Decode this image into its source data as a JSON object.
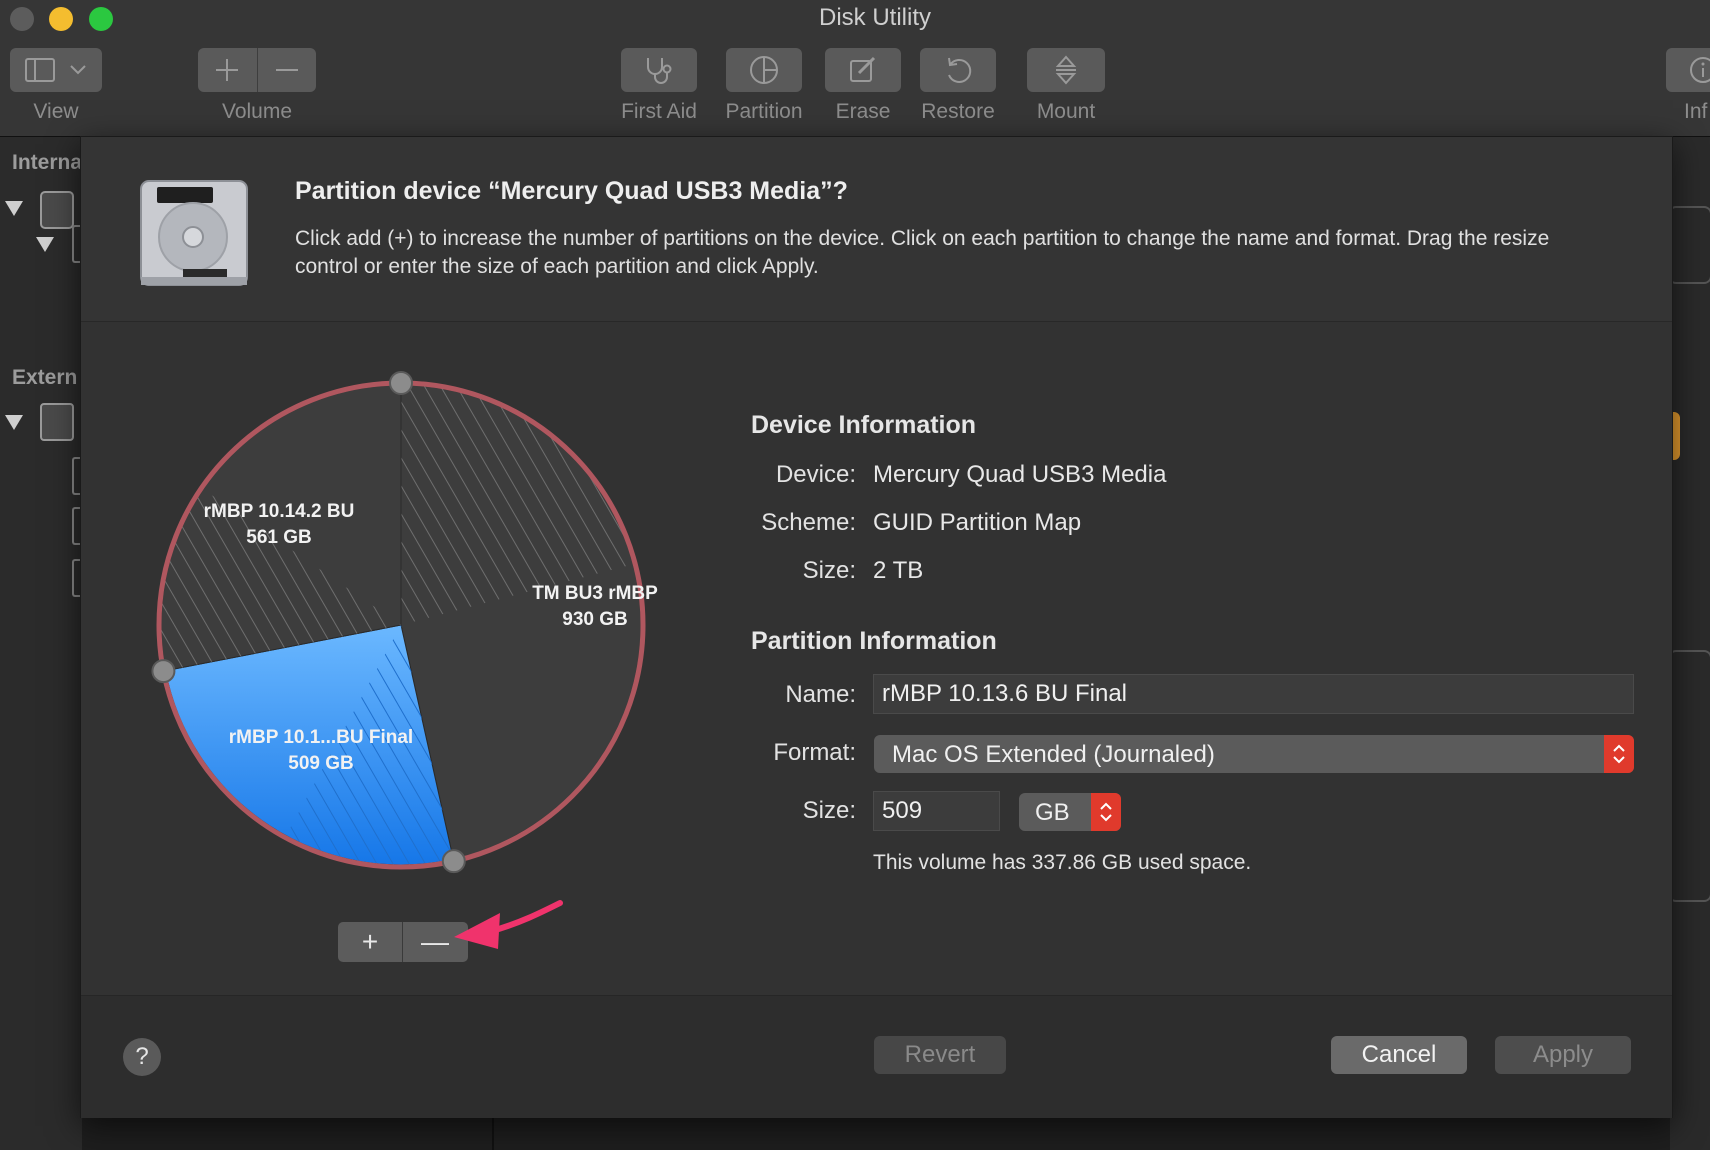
{
  "window": {
    "title": "Disk Utility"
  },
  "toolbar": {
    "view_label": "View",
    "volume_label": "Volume",
    "first_aid_label": "First Aid",
    "partition_label": "Partition",
    "erase_label": "Erase",
    "restore_label": "Restore",
    "mount_label": "Mount",
    "info_label": "Inf"
  },
  "sidebar": {
    "internal_header": "Interna",
    "external_header": "Extern"
  },
  "sheet": {
    "title": "Partition device “Mercury Quad USB3 Media”?",
    "description": "Click add (+) to increase the number of partitions on the device. Click on each partition to change the name and format. Drag the resize control or enter the size of each partition and click Apply."
  },
  "pie": {
    "partitions": [
      {
        "name": "rMBP 10.14.2 BU",
        "size": "561 GB",
        "gb": 561,
        "selected": false
      },
      {
        "name": "TM BU3 rMBP",
        "size": "930 GB",
        "gb": 930,
        "selected": false
      },
      {
        "name": "rMBP 10.1...BU Final",
        "size": "509 GB",
        "gb": 509,
        "selected": true
      }
    ],
    "add_symbol": "+",
    "remove_symbol": "—"
  },
  "device_info": {
    "header": "Device Information",
    "device_label": "Device:",
    "device_value": "Mercury Quad USB3 Media",
    "scheme_label": "Scheme:",
    "scheme_value": "GUID Partition Map",
    "size_label": "Size:",
    "size_value": "2 TB"
  },
  "partition_info": {
    "header": "Partition Information",
    "name_label": "Name:",
    "name_value": "rMBP 10.13.6 BU Final",
    "format_label": "Format:",
    "format_value": "Mac OS Extended (Journaled)",
    "size_label": "Size:",
    "size_value": "509",
    "unit_value": "GB",
    "used_note": "This volume has 337.86 GB used space."
  },
  "footer": {
    "help_symbol": "?",
    "revert_label": "Revert",
    "cancel_label": "Cancel",
    "apply_label": "Apply"
  },
  "colors": {
    "selected_partition": "#2f8ff0",
    "partition_dark": "#3d3d3d",
    "pie_border": "#b0575f",
    "annotation_arrow": "#f0336c",
    "stepper_red": "#e03a2c"
  }
}
